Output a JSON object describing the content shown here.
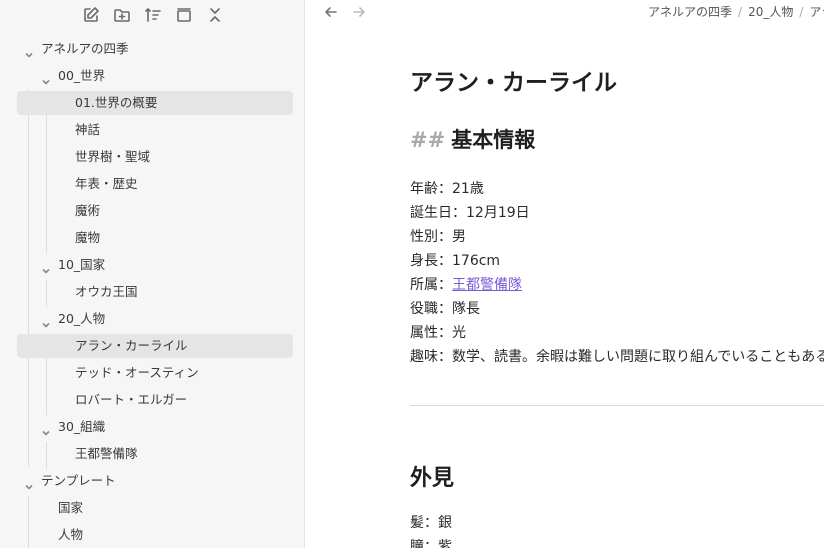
{
  "sidebar": {
    "toolbar": [
      {
        "name": "new-note-icon",
        "label": ""
      },
      {
        "name": "new-folder-icon",
        "label": ""
      },
      {
        "name": "sort-icon",
        "label": ""
      },
      {
        "name": "auto-reveal-icon",
        "label": ""
      },
      {
        "name": "collapse-all-icon",
        "label": ""
      }
    ],
    "tree": [
      {
        "label": "アネルアの四季",
        "type": "folder",
        "open": true,
        "depth": 0
      },
      {
        "label": "00_世界",
        "type": "folder",
        "open": true,
        "depth": 1
      },
      {
        "label": "01.世界の概要",
        "type": "file",
        "depth": 2,
        "active": true
      },
      {
        "label": "神話",
        "type": "file",
        "depth": 2
      },
      {
        "label": "世界樹・聖域",
        "type": "file",
        "depth": 2
      },
      {
        "label": "年表・歴史",
        "type": "file",
        "depth": 2
      },
      {
        "label": "魔術",
        "type": "file",
        "depth": 2
      },
      {
        "label": "魔物",
        "type": "file",
        "depth": 2
      },
      {
        "label": "10_国家",
        "type": "folder",
        "open": true,
        "depth": 1
      },
      {
        "label": "オウカ王国",
        "type": "file",
        "depth": 2
      },
      {
        "label": "20_人物",
        "type": "folder",
        "open": true,
        "depth": 1
      },
      {
        "label": "アラン・カーライル",
        "type": "file",
        "depth": 2,
        "active": true
      },
      {
        "label": "テッド・オースティン",
        "type": "file",
        "depth": 2
      },
      {
        "label": "ロバート・エルガー",
        "type": "file",
        "depth": 2
      },
      {
        "label": "30_組織",
        "type": "folder",
        "open": true,
        "depth": 1
      },
      {
        "label": "王都警備隊",
        "type": "file",
        "depth": 2
      },
      {
        "label": "テンプレート",
        "type": "folder",
        "open": true,
        "depth": 0
      },
      {
        "label": "国家",
        "type": "file",
        "depth": 1
      },
      {
        "label": "人物",
        "type": "file",
        "depth": 1
      }
    ]
  },
  "main": {
    "breadcrumb": [
      "アネルアの四季",
      "20_人物",
      "アラ"
    ],
    "title": "アラン・カーライル",
    "section": {
      "hash": "##",
      "heading": "基本情報"
    },
    "properties": [
      {
        "key": "年齢",
        "value": "21歳"
      },
      {
        "key": "誕生日",
        "value": "12月19日"
      },
      {
        "key": "性別",
        "value": "男"
      },
      {
        "key": "身長",
        "value": "176cm"
      },
      {
        "key": "所属",
        "value": "王都警備隊",
        "link": true
      },
      {
        "key": "役職",
        "value": "隊長"
      },
      {
        "key": "属性",
        "value": "光"
      },
      {
        "key": "趣味",
        "value": "数学、読書。余暇は難しい問題に取り組んでいることもある"
      }
    ],
    "heading2": "外見",
    "appearance": [
      {
        "key": "髪",
        "value": "銀"
      },
      {
        "key": "瞳",
        "value": "紫"
      }
    ],
    "colors": {
      "link": "#7b5cd6",
      "sidebar_bg": "#f6f6f6",
      "active_bg": "#e5e5e5"
    }
  }
}
